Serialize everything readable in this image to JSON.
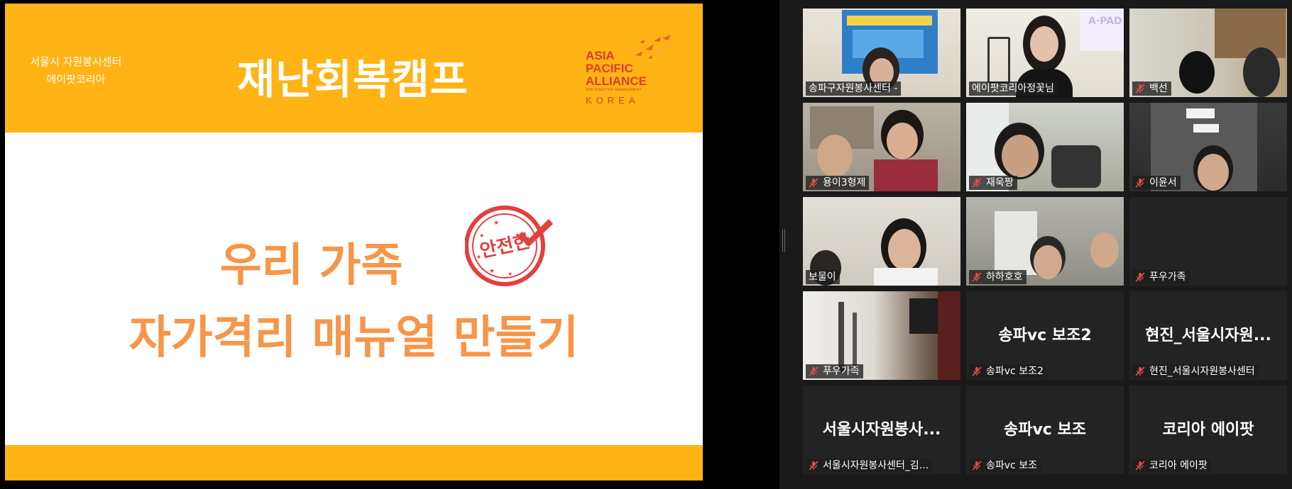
{
  "shared_slide": {
    "org_line1": "서울시 자원봉사센터",
    "org_line2": "에이팟코리아",
    "camp_title": "재난회복캠프",
    "logo": {
      "line1": "ASIA",
      "line2": "PACIFIC",
      "line3": "ALLIANCE",
      "sub": "FOR DISASTER MANAGEMENT",
      "country": "KOREA"
    },
    "headline_line1": "우리 가족",
    "stamp_text": "안전한",
    "headline_line2": "자가격리 매뉴얼 만들기",
    "colors": {
      "header": "#FFB314",
      "headline": "#F79548",
      "stamp": "#E2403F"
    }
  },
  "participants": [
    {
      "name": "송파구자원봉사센터 -",
      "muted": false,
      "video": true
    },
    {
      "name": "에이팟코리아정꽃님",
      "muted": false,
      "video": true,
      "active_speaker": true
    },
    {
      "name": "백선",
      "muted": true,
      "video": true
    },
    {
      "name": "용이3형제",
      "muted": true,
      "video": true
    },
    {
      "name": "재욱짱",
      "muted": true,
      "video": true
    },
    {
      "name": "이윤서",
      "muted": true,
      "video": true
    },
    {
      "name": "보물이",
      "muted": false,
      "video": true
    },
    {
      "name": "하하호호",
      "muted": true,
      "video": true
    },
    {
      "name": "푸우가족",
      "muted": true,
      "video": false
    },
    {
      "name": "푸우가족",
      "muted": true,
      "video": true
    },
    {
      "name": "송파vc 보조2",
      "display_name": "송파vc 보조2",
      "muted": true,
      "video": false
    },
    {
      "name": "현진_서울시자원봉사센터",
      "display_name": "현진_서울시자원...",
      "muted": true,
      "video": false
    },
    {
      "name": "서울시자원봉사센터_김...",
      "display_name": "서울시자원봉사...",
      "muted": true,
      "video": false
    },
    {
      "name": "송파vc 보조",
      "display_name": "송파vc 보조",
      "muted": true,
      "video": false
    },
    {
      "name": "코리아 에이팟",
      "display_name": "코리아 에이팟",
      "muted": true,
      "video": false
    }
  ],
  "icons": {
    "muted_mic": "mic-off-icon",
    "active_border": "#f0e68c"
  }
}
